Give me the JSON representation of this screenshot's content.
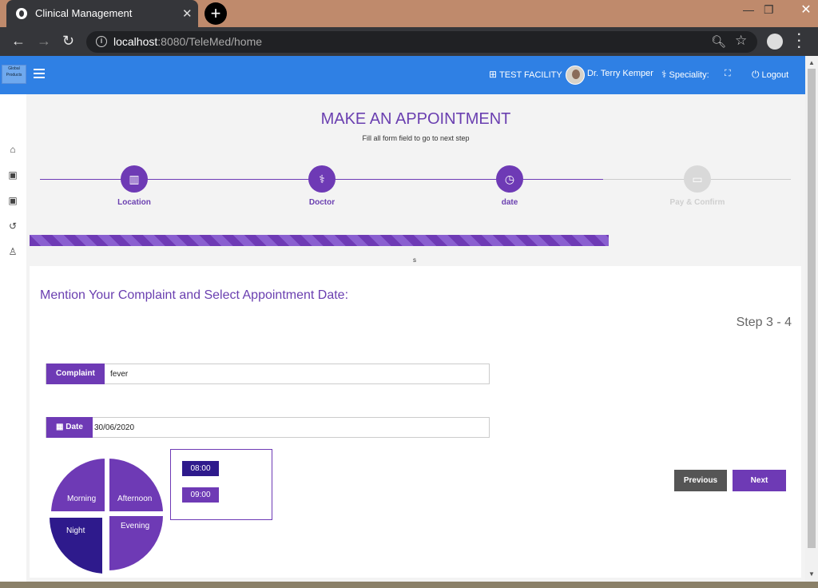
{
  "browser": {
    "tab_title": "Clinical Management",
    "url_host": "localhost",
    "url_path": ":8080/TeleMed/home"
  },
  "appbar": {
    "logo_text": "Global Products",
    "facility": "TEST FACILITY",
    "doctor": "Dr. Terry Kemper",
    "speciality": "Speciality:",
    "logout": "Logout"
  },
  "header": {
    "title": "MAKE AN APPOINTMENT",
    "subtitle": "Fill all form field to go to next step"
  },
  "steps": [
    {
      "label": "Location",
      "icon": "map-icon",
      "active": true
    },
    {
      "label": "Doctor",
      "icon": "stethoscope-icon",
      "active": true
    },
    {
      "label": "date",
      "icon": "clock-icon",
      "active": true
    },
    {
      "label": "Pay & Confirm",
      "icon": "credit-card-icon",
      "active": false
    }
  ],
  "progress_marker": "s",
  "progress_fraction": 0.75,
  "form": {
    "title": "Mention Your Complaint and Select Appointment Date:",
    "step_count": "Step 3 - 4",
    "complaint_label": "Complaint",
    "complaint_value": "fever",
    "date_label": "Date",
    "date_value": "30/06/2020"
  },
  "time_periods": [
    {
      "label": "Morning",
      "color": "#6e3ab5"
    },
    {
      "label": "Afternoon",
      "color": "#6e3ab5"
    },
    {
      "label": "Evening",
      "color": "#6e3ab5"
    },
    {
      "label": "Night",
      "color": "#2e1a8c",
      "selected": true
    }
  ],
  "slots": [
    {
      "label": "08:00",
      "color": "#2e1a8c"
    },
    {
      "label": "09:00",
      "color": "#6e3ab5"
    }
  ],
  "buttons": {
    "previous": "Previous",
    "next": "Next"
  },
  "colors": {
    "accent": "#6e3ab5",
    "appbar": "#2f80e4",
    "previous_button": "#555555"
  }
}
